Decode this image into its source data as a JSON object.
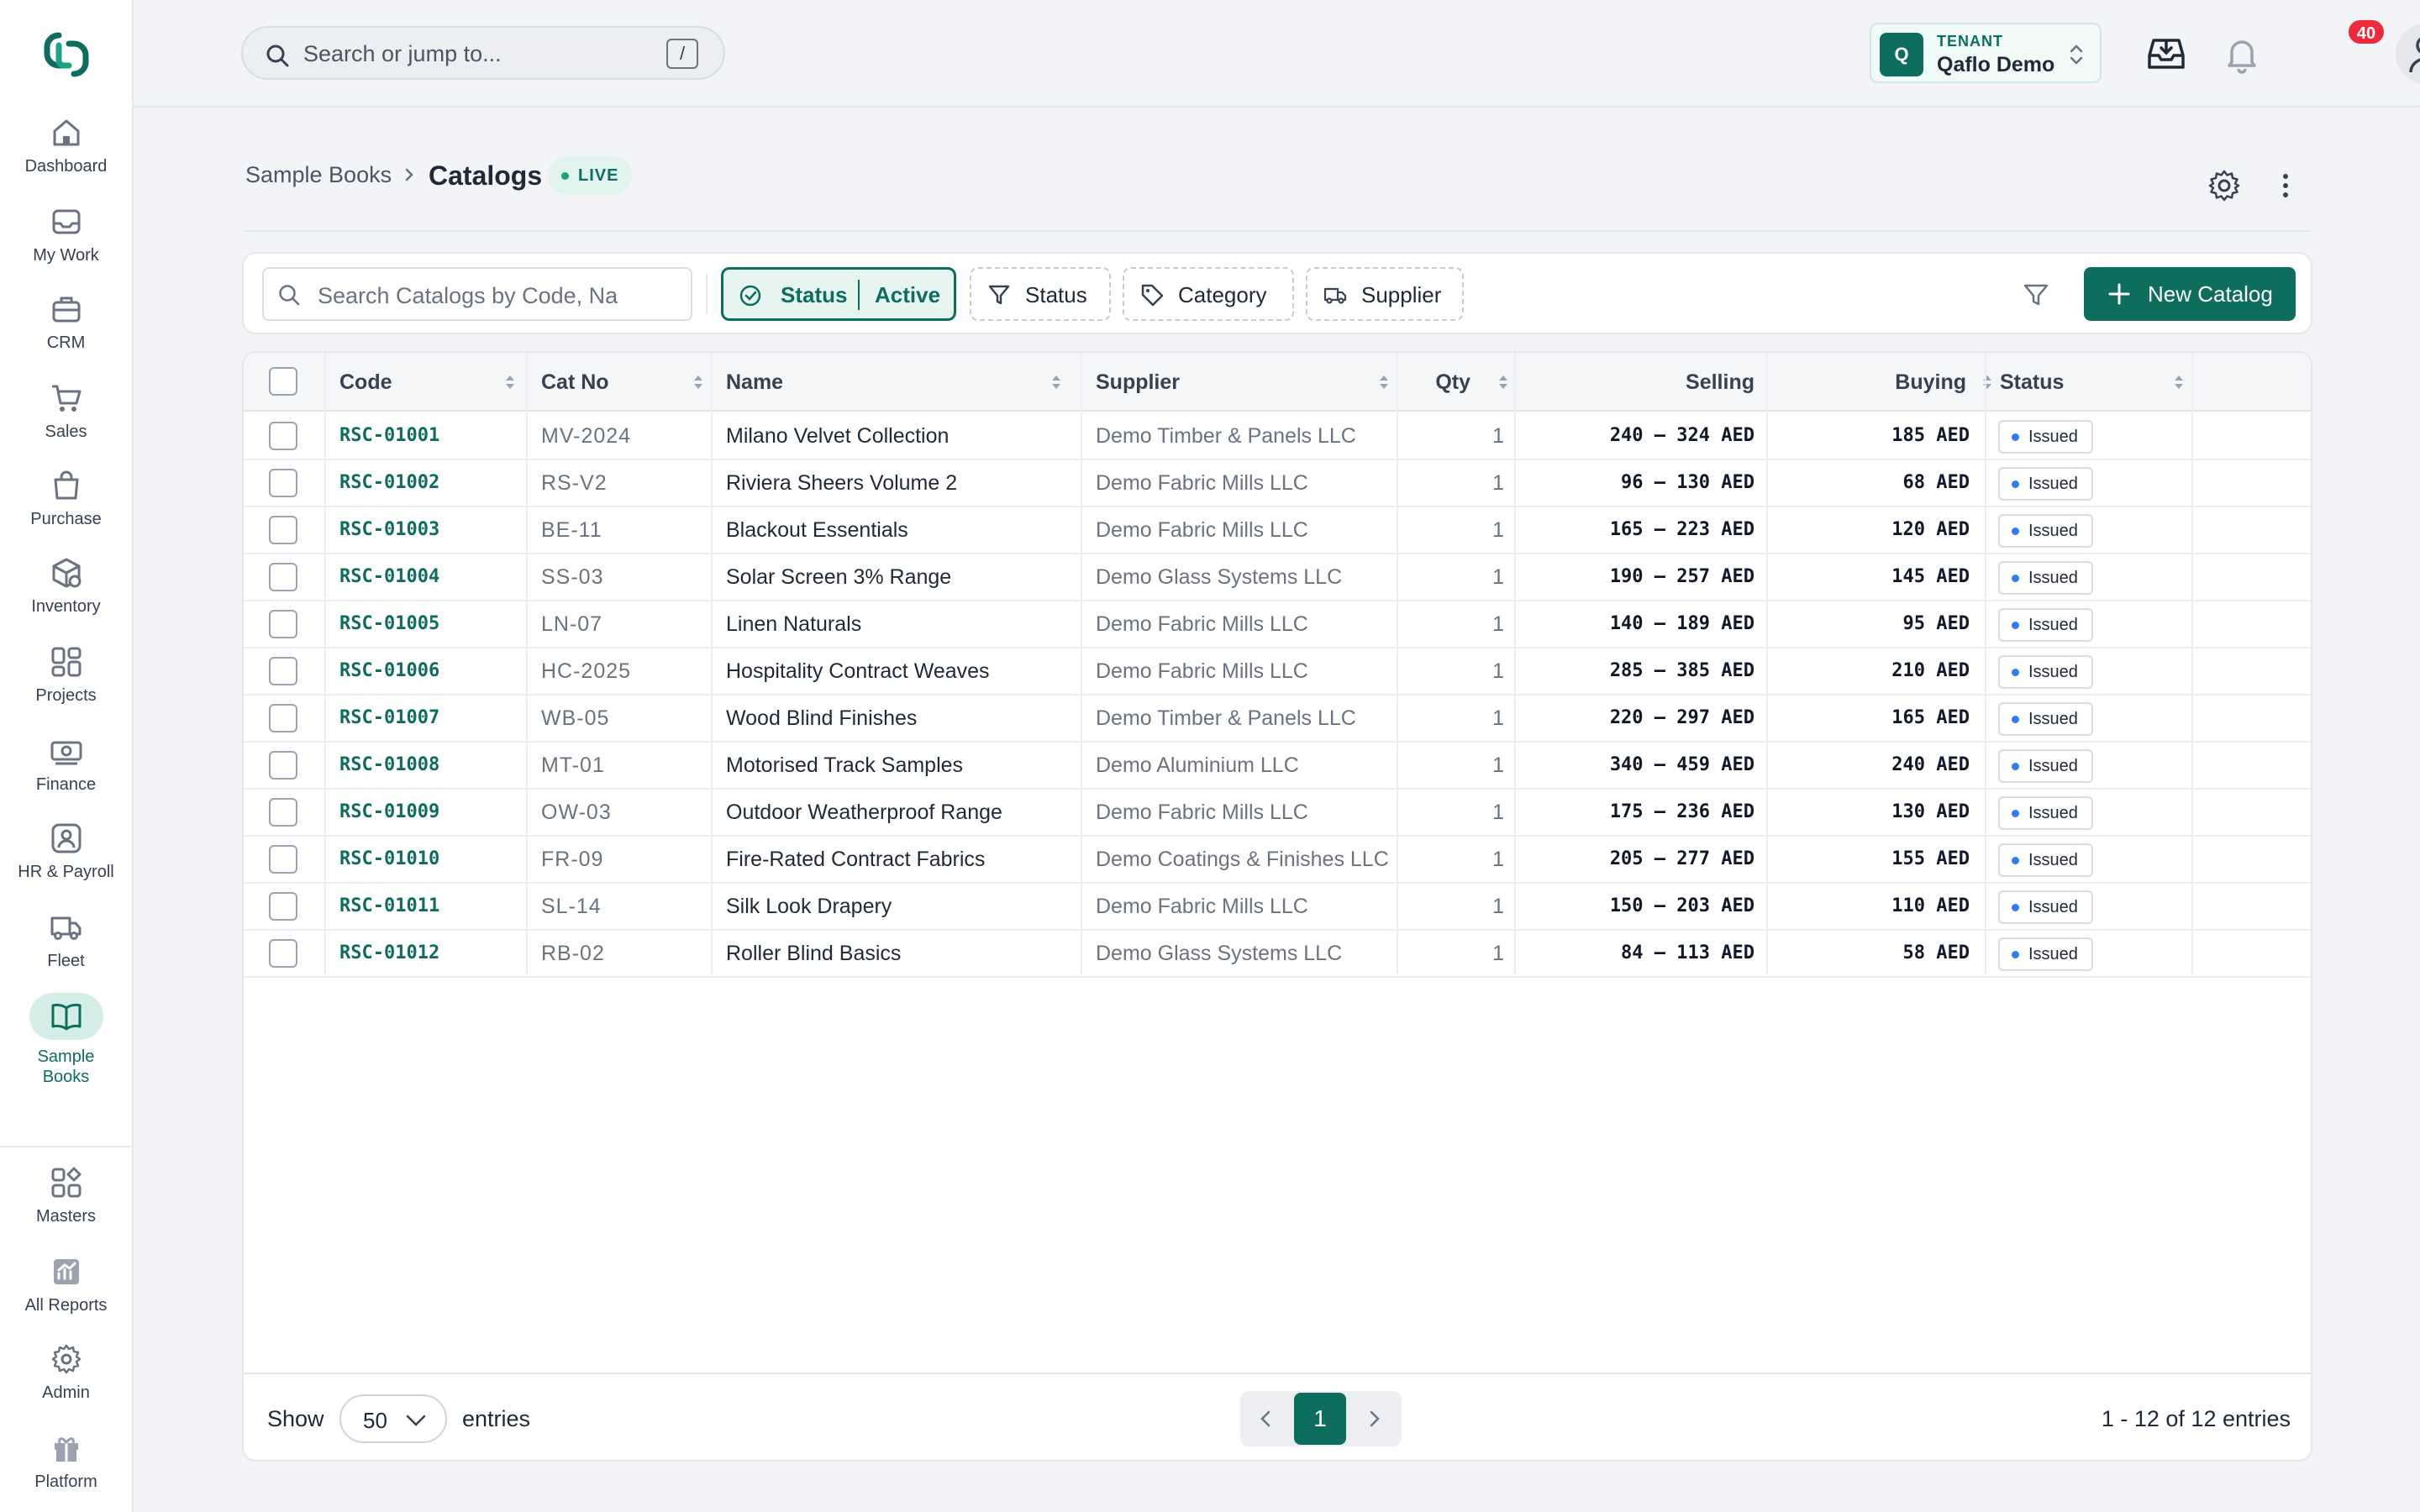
{
  "sidebar": {
    "items": [
      {
        "label": "Dashboard",
        "icon": "home-icon"
      },
      {
        "label": "My Work",
        "icon": "inbox-icon"
      },
      {
        "label": "CRM",
        "icon": "briefcase-icon"
      },
      {
        "label": "Sales",
        "icon": "cart-icon"
      },
      {
        "label": "Purchase",
        "icon": "shopping-bag-icon"
      },
      {
        "label": "Inventory",
        "icon": "box-icon"
      },
      {
        "label": "Projects",
        "icon": "grid-icon"
      },
      {
        "label": "Finance",
        "icon": "banknote-icon"
      },
      {
        "label": "HR & Payroll",
        "icon": "person-badge-icon"
      },
      {
        "label": "Fleet",
        "icon": "truck-icon"
      },
      {
        "label": "Sample\nBooks",
        "icon": "book-open-icon",
        "active": true
      }
    ],
    "bottom_items": [
      {
        "label": "Masters",
        "icon": "shapes-icon"
      },
      {
        "label": "All Reports",
        "icon": "report-icon"
      },
      {
        "label": "Admin",
        "icon": "gear-icon"
      },
      {
        "label": "Platform",
        "icon": "gift-icon"
      }
    ]
  },
  "topbar": {
    "search_placeholder": "Search or jump to...",
    "search_shortcut": "/",
    "tenant_label": "TENANT",
    "tenant_initial": "Q",
    "tenant_name": "Qaflo Demo",
    "notification_count": "40"
  },
  "page": {
    "breadcrumb_root": "Sample Books",
    "title": "Catalogs",
    "status_badge": "LIVE"
  },
  "filters": {
    "search_placeholder": "Search Catalogs by Code, Na",
    "active_chip_label": "Status",
    "active_chip_value": "Active",
    "chips": [
      "Status",
      "Category",
      "Supplier"
    ],
    "new_button": "New Catalog"
  },
  "table": {
    "columns": [
      "Code",
      "Cat No",
      "Name",
      "Supplier",
      "Qty",
      "Selling",
      "Buying",
      "Status"
    ],
    "rows": [
      {
        "code": "RSC-01001",
        "cat_no": "MV-2024",
        "name": "Milano Velvet Collection",
        "supplier": "Demo Timber & Panels LLC",
        "qty": "1",
        "selling": "240 – 324 AED",
        "buying": "185 AED",
        "status": "Issued"
      },
      {
        "code": "RSC-01002",
        "cat_no": "RS-V2",
        "name": "Riviera Sheers Volume 2",
        "supplier": "Demo Fabric Mills LLC",
        "qty": "1",
        "selling": "96 – 130 AED",
        "buying": "68 AED",
        "status": "Issued"
      },
      {
        "code": "RSC-01003",
        "cat_no": "BE-11",
        "name": "Blackout Essentials",
        "supplier": "Demo Fabric Mills LLC",
        "qty": "1",
        "selling": "165 – 223 AED",
        "buying": "120 AED",
        "status": "Issued"
      },
      {
        "code": "RSC-01004",
        "cat_no": "SS-03",
        "name": "Solar Screen 3% Range",
        "supplier": "Demo Glass Systems LLC",
        "qty": "1",
        "selling": "190 – 257 AED",
        "buying": "145 AED",
        "status": "Issued"
      },
      {
        "code": "RSC-01005",
        "cat_no": "LN-07",
        "name": "Linen Naturals",
        "supplier": "Demo Fabric Mills LLC",
        "qty": "1",
        "selling": "140 – 189 AED",
        "buying": "95 AED",
        "status": "Issued"
      },
      {
        "code": "RSC-01006",
        "cat_no": "HC-2025",
        "name": "Hospitality Contract Weaves",
        "supplier": "Demo Fabric Mills LLC",
        "qty": "1",
        "selling": "285 – 385 AED",
        "buying": "210 AED",
        "status": "Issued"
      },
      {
        "code": "RSC-01007",
        "cat_no": "WB-05",
        "name": "Wood Blind Finishes",
        "supplier": "Demo Timber & Panels LLC",
        "qty": "1",
        "selling": "220 – 297 AED",
        "buying": "165 AED",
        "status": "Issued"
      },
      {
        "code": "RSC-01008",
        "cat_no": "MT-01",
        "name": "Motorised Track Samples",
        "supplier": "Demo Aluminium LLC",
        "qty": "1",
        "selling": "340 – 459 AED",
        "buying": "240 AED",
        "status": "Issued"
      },
      {
        "code": "RSC-01009",
        "cat_no": "OW-03",
        "name": "Outdoor Weatherproof Range",
        "supplier": "Demo Fabric Mills LLC",
        "qty": "1",
        "selling": "175 – 236 AED",
        "buying": "130 AED",
        "status": "Issued"
      },
      {
        "code": "RSC-01010",
        "cat_no": "FR-09",
        "name": "Fire-Rated Contract Fabrics",
        "supplier": "Demo Coatings & Finishes LLC",
        "qty": "1",
        "selling": "205 – 277 AED",
        "buying": "155 AED",
        "status": "Issued"
      },
      {
        "code": "RSC-01011",
        "cat_no": "SL-14",
        "name": "Silk Look Drapery",
        "supplier": "Demo Fabric Mills LLC",
        "qty": "1",
        "selling": "150 – 203 AED",
        "buying": "110 AED",
        "status": "Issued"
      },
      {
        "code": "RSC-01012",
        "cat_no": "RB-02",
        "name": "Roller Blind Basics",
        "supplier": "Demo Glass Systems LLC",
        "qty": "1",
        "selling": "84 – 113 AED",
        "buying": "58 AED",
        "status": "Issued"
      }
    ]
  },
  "footer": {
    "show_label": "Show",
    "page_size": "50",
    "entries_label": "entries",
    "current_page": "1",
    "range_text": "1 - 12 of 12 entries"
  },
  "colors": {
    "brand": "#0d6e5e",
    "status_dot": "#2f7bf5",
    "notification": "#ef2b3a"
  }
}
